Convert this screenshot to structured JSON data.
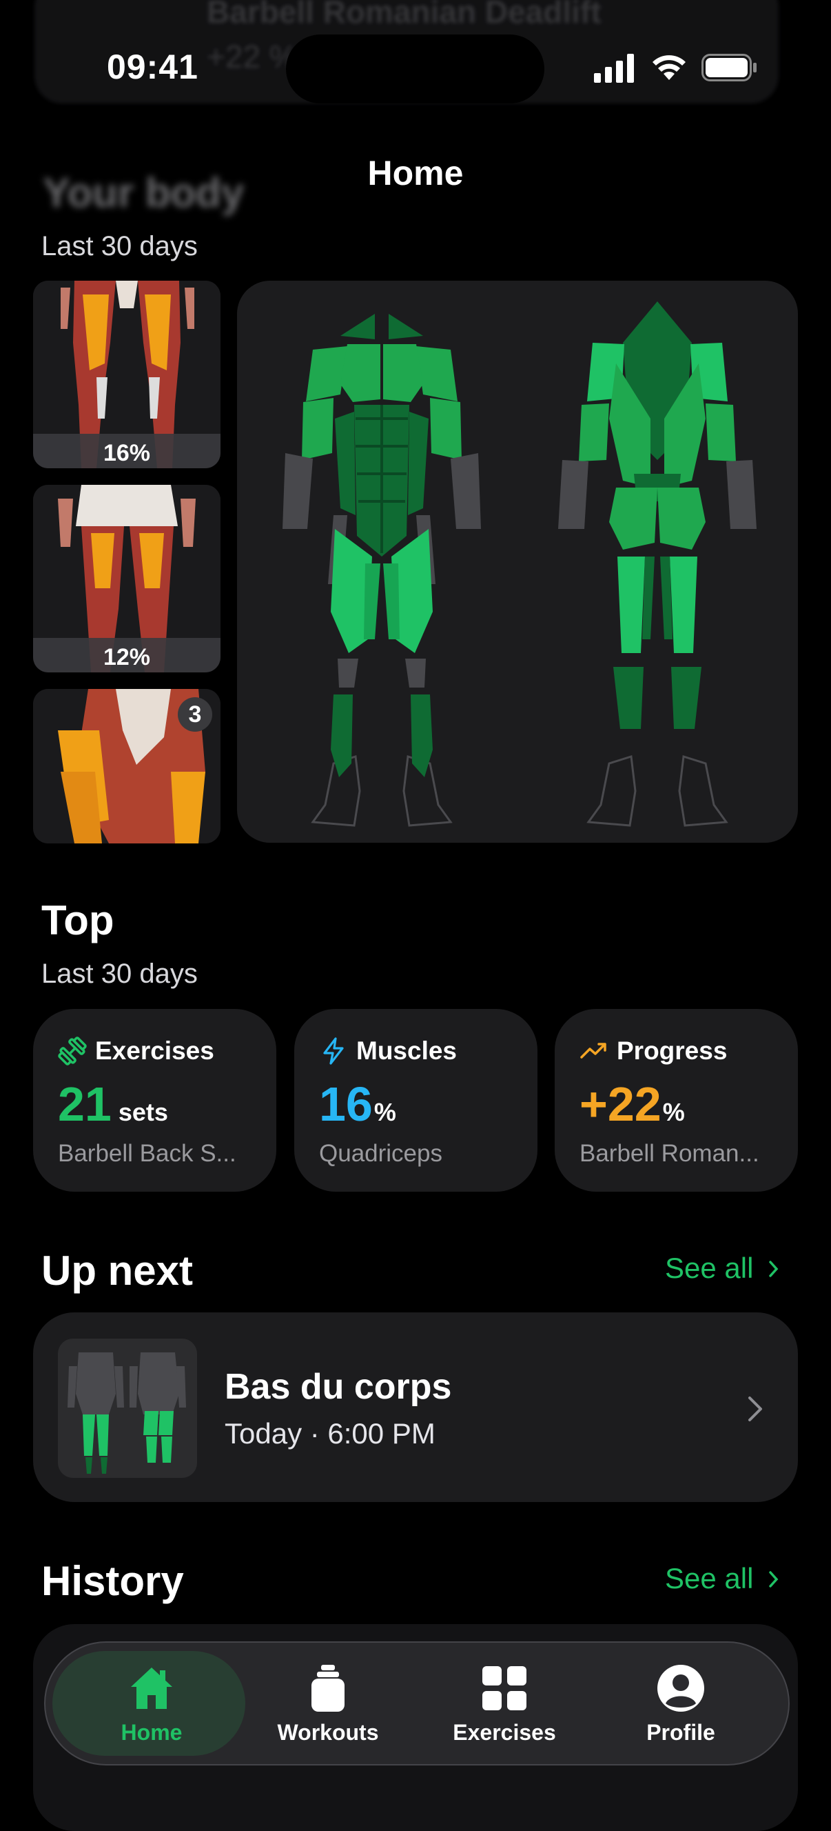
{
  "status_bar": {
    "time": "09:41"
  },
  "background_ghost": {
    "title": "Barbell Romanian Deadlift",
    "subtitle": "+22 %"
  },
  "nav": {
    "title": "Home"
  },
  "body_section": {
    "title": "Your body",
    "subtitle": "Last 30 days",
    "thumbnails": [
      {
        "percent": "16%"
      },
      {
        "percent": "12%"
      },
      {
        "badge": "3"
      }
    ]
  },
  "top_section": {
    "title": "Top",
    "subtitle": "Last 30 days",
    "cards": [
      {
        "label": "Exercises",
        "value": "21",
        "unit": "sets",
        "detail": "Barbell Back S...",
        "color": "#1fc265",
        "icon": "dumbbell-icon"
      },
      {
        "label": "Muscles",
        "value": "16",
        "unit": "%",
        "detail": "Quadriceps",
        "color": "#27b6f5",
        "icon": "bolt-icon"
      },
      {
        "label": "Progress",
        "value": "+22",
        "unit": "%",
        "detail": "Barbell Roman...",
        "color": "#f5a524",
        "icon": "trend-up-icon"
      }
    ]
  },
  "up_next": {
    "title": "Up next",
    "see_all": "See all",
    "workout": {
      "name": "Bas du corps",
      "when": "Today · 6:00 PM"
    }
  },
  "history": {
    "title": "History",
    "see_all": "See all"
  },
  "tabbar": {
    "tabs": [
      {
        "label": "Home",
        "icon": "house-icon",
        "active": true
      },
      {
        "label": "Workouts",
        "icon": "bottle-icon",
        "active": false
      },
      {
        "label": "Exercises",
        "icon": "grid-icon",
        "active": false
      },
      {
        "label": "Profile",
        "icon": "person-circle-icon",
        "active": false
      }
    ]
  },
  "colors": {
    "accent": "#1fc265",
    "muscle_primary": "#1fa84f",
    "muscle_secondary": "#0f6b33",
    "card": "#1c1c1e"
  }
}
